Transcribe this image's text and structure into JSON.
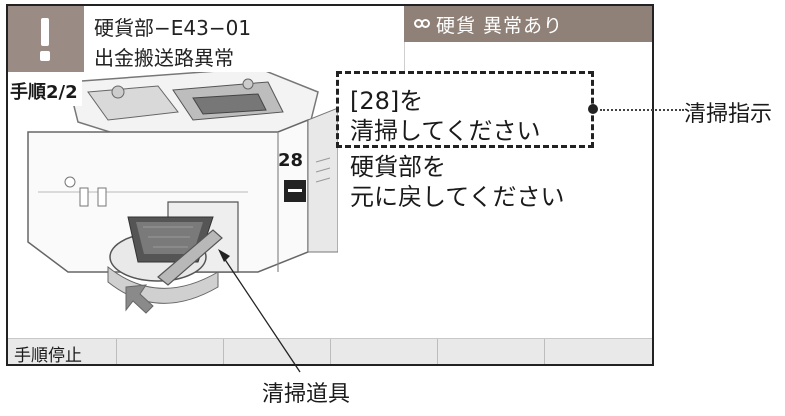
{
  "header": {
    "error_code": "硬貨部−E43−01",
    "error_name": "出金搬送路異常",
    "status": "硬貨 異常あり"
  },
  "step": "手順2/2",
  "illustration": {
    "part_number": "28"
  },
  "instructions": {
    "highlighted": [
      "[28]を",
      "清掃してください"
    ],
    "next": [
      "硬貨部を",
      "元に戻してください"
    ]
  },
  "footer": {
    "buttons": [
      "手順停止",
      "",
      "",
      "",
      "",
      ""
    ]
  },
  "callouts": {
    "instruction": "清掃指示",
    "tool": "清掃道具"
  }
}
